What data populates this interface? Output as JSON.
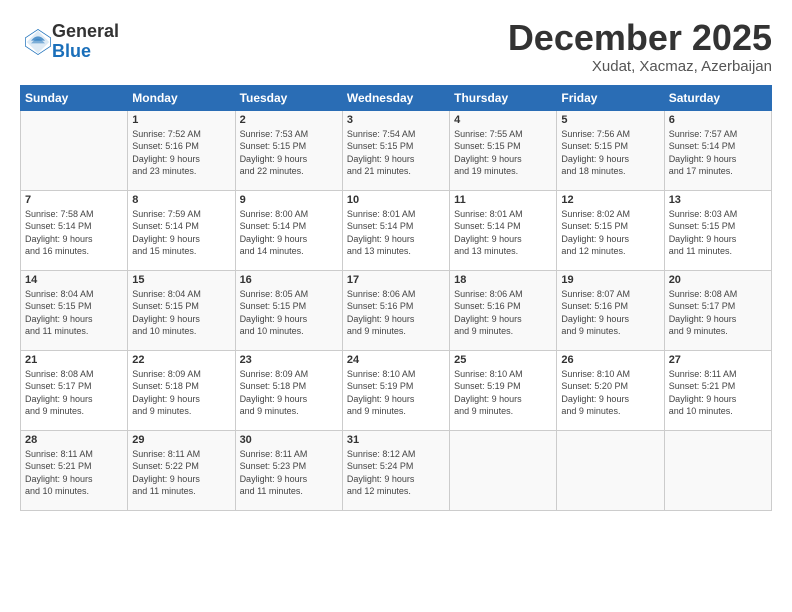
{
  "header": {
    "logo_general": "General",
    "logo_blue": "Blue",
    "month": "December 2025",
    "location": "Xudat, Xacmaz, Azerbaijan"
  },
  "days_header": [
    "Sunday",
    "Monday",
    "Tuesday",
    "Wednesday",
    "Thursday",
    "Friday",
    "Saturday"
  ],
  "weeks": [
    [
      {
        "day": "",
        "info": ""
      },
      {
        "day": "1",
        "info": "Sunrise: 7:52 AM\nSunset: 5:16 PM\nDaylight: 9 hours\nand 23 minutes."
      },
      {
        "day": "2",
        "info": "Sunrise: 7:53 AM\nSunset: 5:15 PM\nDaylight: 9 hours\nand 22 minutes."
      },
      {
        "day": "3",
        "info": "Sunrise: 7:54 AM\nSunset: 5:15 PM\nDaylight: 9 hours\nand 21 minutes."
      },
      {
        "day": "4",
        "info": "Sunrise: 7:55 AM\nSunset: 5:15 PM\nDaylight: 9 hours\nand 19 minutes."
      },
      {
        "day": "5",
        "info": "Sunrise: 7:56 AM\nSunset: 5:15 PM\nDaylight: 9 hours\nand 18 minutes."
      },
      {
        "day": "6",
        "info": "Sunrise: 7:57 AM\nSunset: 5:14 PM\nDaylight: 9 hours\nand 17 minutes."
      }
    ],
    [
      {
        "day": "7",
        "info": "Sunrise: 7:58 AM\nSunset: 5:14 PM\nDaylight: 9 hours\nand 16 minutes."
      },
      {
        "day": "8",
        "info": "Sunrise: 7:59 AM\nSunset: 5:14 PM\nDaylight: 9 hours\nand 15 minutes."
      },
      {
        "day": "9",
        "info": "Sunrise: 8:00 AM\nSunset: 5:14 PM\nDaylight: 9 hours\nand 14 minutes."
      },
      {
        "day": "10",
        "info": "Sunrise: 8:01 AM\nSunset: 5:14 PM\nDaylight: 9 hours\nand 13 minutes."
      },
      {
        "day": "11",
        "info": "Sunrise: 8:01 AM\nSunset: 5:14 PM\nDaylight: 9 hours\nand 13 minutes."
      },
      {
        "day": "12",
        "info": "Sunrise: 8:02 AM\nSunset: 5:15 PM\nDaylight: 9 hours\nand 12 minutes."
      },
      {
        "day": "13",
        "info": "Sunrise: 8:03 AM\nSunset: 5:15 PM\nDaylight: 9 hours\nand 11 minutes."
      }
    ],
    [
      {
        "day": "14",
        "info": "Sunrise: 8:04 AM\nSunset: 5:15 PM\nDaylight: 9 hours\nand 11 minutes."
      },
      {
        "day": "15",
        "info": "Sunrise: 8:04 AM\nSunset: 5:15 PM\nDaylight: 9 hours\nand 10 minutes."
      },
      {
        "day": "16",
        "info": "Sunrise: 8:05 AM\nSunset: 5:15 PM\nDaylight: 9 hours\nand 10 minutes."
      },
      {
        "day": "17",
        "info": "Sunrise: 8:06 AM\nSunset: 5:16 PM\nDaylight: 9 hours\nand 9 minutes."
      },
      {
        "day": "18",
        "info": "Sunrise: 8:06 AM\nSunset: 5:16 PM\nDaylight: 9 hours\nand 9 minutes."
      },
      {
        "day": "19",
        "info": "Sunrise: 8:07 AM\nSunset: 5:16 PM\nDaylight: 9 hours\nand 9 minutes."
      },
      {
        "day": "20",
        "info": "Sunrise: 8:08 AM\nSunset: 5:17 PM\nDaylight: 9 hours\nand 9 minutes."
      }
    ],
    [
      {
        "day": "21",
        "info": "Sunrise: 8:08 AM\nSunset: 5:17 PM\nDaylight: 9 hours\nand 9 minutes."
      },
      {
        "day": "22",
        "info": "Sunrise: 8:09 AM\nSunset: 5:18 PM\nDaylight: 9 hours\nand 9 minutes."
      },
      {
        "day": "23",
        "info": "Sunrise: 8:09 AM\nSunset: 5:18 PM\nDaylight: 9 hours\nand 9 minutes."
      },
      {
        "day": "24",
        "info": "Sunrise: 8:10 AM\nSunset: 5:19 PM\nDaylight: 9 hours\nand 9 minutes."
      },
      {
        "day": "25",
        "info": "Sunrise: 8:10 AM\nSunset: 5:19 PM\nDaylight: 9 hours\nand 9 minutes."
      },
      {
        "day": "26",
        "info": "Sunrise: 8:10 AM\nSunset: 5:20 PM\nDaylight: 9 hours\nand 9 minutes."
      },
      {
        "day": "27",
        "info": "Sunrise: 8:11 AM\nSunset: 5:21 PM\nDaylight: 9 hours\nand 10 minutes."
      }
    ],
    [
      {
        "day": "28",
        "info": "Sunrise: 8:11 AM\nSunset: 5:21 PM\nDaylight: 9 hours\nand 10 minutes."
      },
      {
        "day": "29",
        "info": "Sunrise: 8:11 AM\nSunset: 5:22 PM\nDaylight: 9 hours\nand 11 minutes."
      },
      {
        "day": "30",
        "info": "Sunrise: 8:11 AM\nSunset: 5:23 PM\nDaylight: 9 hours\nand 11 minutes."
      },
      {
        "day": "31",
        "info": "Sunrise: 8:12 AM\nSunset: 5:24 PM\nDaylight: 9 hours\nand 12 minutes."
      },
      {
        "day": "",
        "info": ""
      },
      {
        "day": "",
        "info": ""
      },
      {
        "day": "",
        "info": ""
      }
    ]
  ]
}
